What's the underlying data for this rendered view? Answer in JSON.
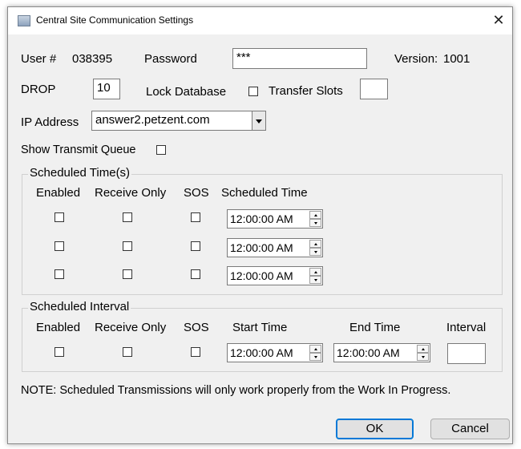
{
  "window": {
    "title": "Central Site Communication Settings",
    "close_glyph": "✕"
  },
  "row1": {
    "user_label": "User #",
    "user_value": "038395",
    "password_label": "Password",
    "password_value": "***",
    "version_label": "Version:",
    "version_value": "1001"
  },
  "row2": {
    "drop_label": "DROP",
    "drop_value": "10",
    "lock_label": "Lock Database",
    "lock_checked": false,
    "transfer_label": "Transfer Slots",
    "transfer_value": ""
  },
  "row3": {
    "ip_label": "IP Address",
    "ip_value": "answer2.petzent.com"
  },
  "row4": {
    "show_queue_label": "Show Transmit Queue",
    "show_queue_checked": false
  },
  "scheduled_times": {
    "title": "Scheduled Time(s)",
    "headers": {
      "enabled": "Enabled",
      "receive_only": "Receive Only",
      "sos": "SOS",
      "scheduled_time": "Scheduled Time"
    },
    "rows": [
      {
        "enabled": false,
        "receive_only": false,
        "sos": false,
        "time": "12:00:00 AM"
      },
      {
        "enabled": false,
        "receive_only": false,
        "sos": false,
        "time": "12:00:00 AM"
      },
      {
        "enabled": false,
        "receive_only": false,
        "sos": false,
        "time": "12:00:00 AM"
      }
    ]
  },
  "scheduled_interval": {
    "title": "Scheduled Interval",
    "headers": {
      "enabled": "Enabled",
      "receive_only": "Receive Only",
      "sos": "SOS",
      "start_time": "Start Time",
      "end_time": "End Time",
      "interval": "Interval"
    },
    "row": {
      "enabled": false,
      "receive_only": false,
      "sos": false,
      "start": "12:00:00 AM",
      "end": "12:00:00 AM",
      "interval": ""
    }
  },
  "note": "NOTE: Scheduled Transmissions will only work properly from the Work In Progress.",
  "buttons": {
    "ok": "OK",
    "cancel": "Cancel"
  }
}
